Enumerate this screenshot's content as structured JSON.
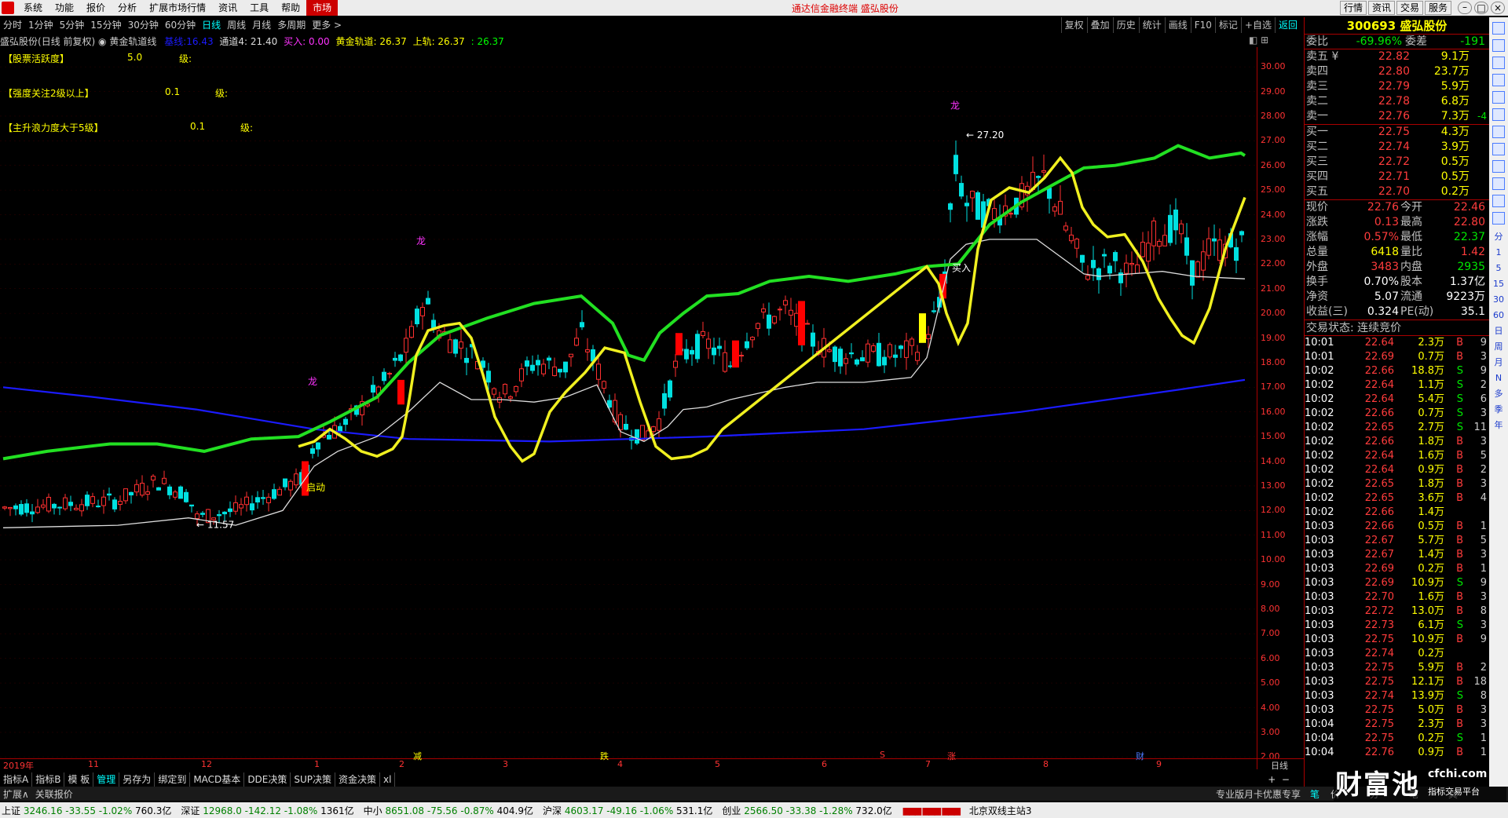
{
  "menu": {
    "items": [
      "系统",
      "功能",
      "报价",
      "分析",
      "扩展市场行情",
      "资讯",
      "工具",
      "帮助",
      "市场"
    ],
    "center_title": "通达信金融终端 盛弘股份",
    "right_items": [
      "行情",
      "资讯",
      "交易",
      "服务"
    ],
    "window_controls": [
      "minimize-icon",
      "maximize-icon",
      "close-icon"
    ]
  },
  "periods": {
    "items": [
      "分时",
      "1分钟",
      "5分钟",
      "15分钟",
      "30分钟",
      "60分钟",
      "日线",
      "周线",
      "月线",
      "多周期",
      "更多 >"
    ],
    "active": "日线",
    "right_items": [
      "复权",
      "叠加",
      "历史",
      "统计",
      "画线",
      "F10",
      "标记",
      "+自选",
      "返回"
    ]
  },
  "infoline": {
    "name": "盛弘股份",
    "mode": "(日线 前复权)",
    "indicator": "黄金轨道线",
    "ind_label": "基线:",
    "ind_value": "16.43",
    "t4": "通道4: 21.40",
    "buy": "买入: 0.00",
    "gold": "黄金轨道: 26.37",
    "upper": "上轨: 26.37",
    "up2": ": 26.37"
  },
  "indicators_text": [
    {
      "label": "【股票活跃度】",
      "value": "5.0",
      "unit": "级:"
    },
    {
      "label": "【强度关注2级以上】",
      "value": "0.1",
      "unit": "级:"
    },
    {
      "label": "【主升浪力度大于5级】",
      "value": "0.1",
      "unit": "级:"
    }
  ],
  "price_axis": [
    "30.00",
    "29.00",
    "28.00",
    "27.00",
    "26.00",
    "25.00",
    "24.00",
    "23.00",
    "22.00",
    "21.00",
    "20.00",
    "19.00",
    "18.00",
    "17.00",
    "16.00",
    "15.00",
    "14.00",
    "13.00",
    "12.00",
    "11.00",
    "10.00",
    "9.00",
    "8.00",
    "7.00",
    "6.00",
    "5.00",
    "4.00",
    "3.00",
    "2.00"
  ],
  "chart_labels": {
    "high_label": "27.20",
    "low_label": "11.57",
    "long1": "龙",
    "long2": "龙",
    "long3": "龙",
    "buy_label": "买入",
    "qi": "启动"
  },
  "date_axis": {
    "start": "2019年",
    "labels": [
      "11",
      "12",
      "1",
      "2",
      "3",
      "4",
      "5",
      "6",
      "7",
      "8",
      "9"
    ],
    "markers": [
      {
        "text": "减",
        "color": "#ffff00"
      },
      {
        "text": "跌",
        "color": "#ffff00"
      },
      {
        "text": "S",
        "color": "#ff3333"
      },
      {
        "text": "涨",
        "color": "#ff3333"
      },
      {
        "text": "财",
        "color": "#4a7bff"
      }
    ],
    "right_label": "日线"
  },
  "bottom_tabs": [
    "指标A",
    "指标B",
    "模 板",
    "管理",
    "另存为",
    "绑定到",
    "MACD基本",
    "DDE决策",
    "SUP决策",
    "资金决策",
    "xl"
  ],
  "bottom_bar2": {
    "left": [
      "扩展∧",
      "关联报价"
    ],
    "right": "专业版月卡优惠专享",
    "pen": "笔",
    "right_items": [
      "价",
      "分",
      "笔",
      "其"
    ]
  },
  "status_bar": [
    {
      "name": "上证",
      "value": "3246.16",
      "chg": "-33.55",
      "pct": "-1.02%",
      "amt": "760.3亿"
    },
    {
      "name": "深证",
      "value": "12968.0",
      "chg": "-142.12",
      "pct": "-1.08%",
      "amt": "1361亿"
    },
    {
      "name": "中小",
      "value": "8651.08",
      "chg": "-75.56",
      "pct": "-0.87%",
      "amt": "404.9亿"
    },
    {
      "name": "沪深",
      "value": "4603.17",
      "chg": "-49.16",
      "pct": "-1.06%",
      "amt": "531.1亿"
    },
    {
      "name": "创业",
      "value": "2566.50",
      "chg": "-33.38",
      "pct": "-1.28%",
      "amt": "732.0亿"
    }
  ],
  "status_right": "北京双线主站3",
  "watermark": {
    "cn": "财富池",
    "url": "cfchi.com",
    "sub": "指标交易平台"
  },
  "quote": {
    "code_name": "300693 盛弘股份",
    "weibi_label": "委比",
    "weibi": "-69.96%",
    "weicha_label": "委差",
    "weicha": "-191",
    "asks": [
      {
        "label": "卖五 ¥",
        "price": "22.82",
        "vol": "9.1万"
      },
      {
        "label": "卖四",
        "price": "22.80",
        "vol": "23.7万"
      },
      {
        "label": "卖三",
        "price": "22.79",
        "vol": "5.9万"
      },
      {
        "label": "卖二",
        "price": "22.78",
        "vol": "6.8万"
      },
      {
        "label": "卖一",
        "price": "22.76",
        "vol": "7.3万",
        "extra": "-4"
      }
    ],
    "bids": [
      {
        "label": "买一",
        "price": "22.75",
        "vol": "4.3万"
      },
      {
        "label": "买二",
        "price": "22.74",
        "vol": "3.9万"
      },
      {
        "label": "买三",
        "price": "22.72",
        "vol": "0.5万"
      },
      {
        "label": "买四",
        "price": "22.71",
        "vol": "0.5万"
      },
      {
        "label": "买五",
        "price": "22.70",
        "vol": "0.2万"
      }
    ],
    "stats": [
      {
        "l1": "现价",
        "v1": "22.76",
        "c1": "red",
        "l2": "今开",
        "v2": "22.46",
        "c2": "red"
      },
      {
        "l1": "涨跌",
        "v1": "0.13",
        "c1": "red",
        "l2": "最高",
        "v2": "22.80",
        "c2": "red"
      },
      {
        "l1": "涨幅",
        "v1": "0.57%",
        "c1": "red",
        "l2": "最低",
        "v2": "22.37",
        "c2": "green"
      },
      {
        "l1": "总量",
        "v1": "6418",
        "c1": "yellow",
        "l2": "量比",
        "v2": "1.42",
        "c2": "red"
      },
      {
        "l1": "外盘",
        "v1": "3483",
        "c1": "red",
        "l2": "内盘",
        "v2": "2935",
        "c2": "green"
      },
      {
        "l1": "换手",
        "v1": "0.70%",
        "c1": "white",
        "l2": "股本",
        "v2": "1.37亿",
        "c2": "white"
      },
      {
        "l1": "净资",
        "v1": "5.07",
        "c1": "white",
        "l2": "流通",
        "v2": "9223万",
        "c2": "white"
      },
      {
        "l1": "收益(三)",
        "v1": "0.324",
        "c1": "white",
        "l2": "PE(动)",
        "v2": "35.1",
        "c2": "white"
      }
    ],
    "trade_state": "交易状态: 连续竞价",
    "ticks": [
      {
        "t": "10:01",
        "p": "22.64",
        "v": "2.3万",
        "d": "B",
        "n": "9"
      },
      {
        "t": "10:01",
        "p": "22.69",
        "v": "0.7万",
        "d": "B",
        "n": "3"
      },
      {
        "t": "10:02",
        "p": "22.66",
        "v": "18.8万",
        "d": "S",
        "n": "9"
      },
      {
        "t": "10:02",
        "p": "22.64",
        "v": "1.1万",
        "d": "S",
        "n": "2"
      },
      {
        "t": "10:02",
        "p": "22.64",
        "v": "5.4万",
        "d": "S",
        "n": "6"
      },
      {
        "t": "10:02",
        "p": "22.66",
        "v": "0.7万",
        "d": "S",
        "n": "3"
      },
      {
        "t": "10:02",
        "p": "22.65",
        "v": "2.7万",
        "d": "S",
        "n": "11"
      },
      {
        "t": "10:02",
        "p": "22.66",
        "v": "1.8万",
        "d": "B",
        "n": "3"
      },
      {
        "t": "10:02",
        "p": "22.64",
        "v": "1.6万",
        "d": "B",
        "n": "5"
      },
      {
        "t": "10:02",
        "p": "22.64",
        "v": "0.9万",
        "d": "B",
        "n": "2"
      },
      {
        "t": "10:02",
        "p": "22.65",
        "v": "1.8万",
        "d": "B",
        "n": "3"
      },
      {
        "t": "10:02",
        "p": "22.65",
        "v": "3.6万",
        "d": "B",
        "n": "4"
      },
      {
        "t": "10:02",
        "p": "22.66",
        "v": "1.4万",
        "d": "",
        "n": ""
      },
      {
        "t": "10:03",
        "p": "22.66",
        "v": "0.5万",
        "d": "B",
        "n": "1"
      },
      {
        "t": "10:03",
        "p": "22.67",
        "v": "5.7万",
        "d": "B",
        "n": "5"
      },
      {
        "t": "10:03",
        "p": "22.67",
        "v": "1.4万",
        "d": "B",
        "n": "3"
      },
      {
        "t": "10:03",
        "p": "22.69",
        "v": "0.2万",
        "d": "B",
        "n": "1"
      },
      {
        "t": "10:03",
        "p": "22.69",
        "v": "10.9万",
        "d": "S",
        "n": "9"
      },
      {
        "t": "10:03",
        "p": "22.70",
        "v": "1.6万",
        "d": "B",
        "n": "3"
      },
      {
        "t": "10:03",
        "p": "22.72",
        "v": "13.0万",
        "d": "B",
        "n": "8"
      },
      {
        "t": "10:03",
        "p": "22.73",
        "v": "6.1万",
        "d": "S",
        "n": "3"
      },
      {
        "t": "10:03",
        "p": "22.75",
        "v": "10.9万",
        "d": "B",
        "n": "9"
      },
      {
        "t": "10:03",
        "p": "22.74",
        "v": "0.2万",
        "d": "",
        "n": ""
      },
      {
        "t": "10:03",
        "p": "22.75",
        "v": "5.9万",
        "d": "B",
        "n": "2"
      },
      {
        "t": "10:03",
        "p": "22.75",
        "v": "12.1万",
        "d": "B",
        "n": "18"
      },
      {
        "t": "10:03",
        "p": "22.74",
        "v": "13.9万",
        "d": "S",
        "n": "8"
      },
      {
        "t": "10:03",
        "p": "22.75",
        "v": "5.0万",
        "d": "B",
        "n": "3"
      },
      {
        "t": "10:04",
        "p": "22.75",
        "v": "2.3万",
        "d": "B",
        "n": "3"
      },
      {
        "t": "10:04",
        "p": "22.75",
        "v": "0.2万",
        "d": "S",
        "n": "1"
      },
      {
        "t": "10:04",
        "p": "22.76",
        "v": "0.9万",
        "d": "B",
        "n": "1"
      }
    ]
  },
  "side_icons": [
    "分",
    "1",
    "5",
    "15",
    "30",
    "60",
    "日",
    "周",
    "月",
    "N",
    "多",
    "季",
    "年"
  ],
  "chart_data": {
    "type": "candlestick",
    "ylim": [
      1.5,
      30.8
    ],
    "x": [
      "11",
      "12",
      "1",
      "2",
      "3",
      "4",
      "5",
      "6",
      "7",
      "8",
      "9"
    ],
    "start_label": "2019年",
    "series": [
      {
        "name": "黄金轨道",
        "color": "#ffff00"
      },
      {
        "name": "上轨",
        "color": "#00ff00"
      },
      {
        "name": "基线",
        "color": "#0000ff"
      },
      {
        "name": "通道4",
        "color": "#ffffff"
      }
    ],
    "high": 27.2,
    "low": 11.57,
    "last": 22.76
  }
}
